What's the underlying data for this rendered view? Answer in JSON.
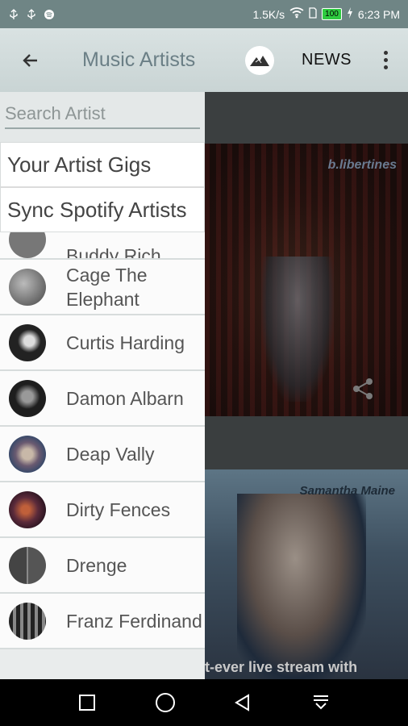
{
  "status": {
    "network_speed": "1.5K/s",
    "battery": "100",
    "time": "6:23 PM"
  },
  "app_bar": {
    "title": "Music Artists",
    "news_label": "NEWS"
  },
  "drawer": {
    "search_placeholder": "Search Artist",
    "menu": [
      "Your Artist Gigs",
      "Sync Spotify Artists"
    ],
    "partial_artist": "Buddy Rich",
    "artists": [
      {
        "name": "Cage The Elephant",
        "color": "#6a6a6a"
      },
      {
        "name": "Curtis Harding",
        "color": "#2b2b2b"
      },
      {
        "name": "Damon Albarn",
        "color": "#3a3a3a"
      },
      {
        "name": "Deap Vally",
        "color": "#7a6a60"
      },
      {
        "name": "Dirty Fences",
        "color": "#5a2a2a"
      },
      {
        "name": "Drenge",
        "color": "#4a4a4a"
      },
      {
        "name": "Franz Ferdinand",
        "color": "#555555"
      }
    ]
  },
  "feed": {
    "card1_caption": "b.libertines",
    "card2_caption": "Samantha Maine",
    "card2_text": "t-ever live stream with"
  },
  "colors": {
    "status_bar": "#6f8585",
    "app_bar": "#d2dcdc",
    "title": "#6b7f86"
  }
}
